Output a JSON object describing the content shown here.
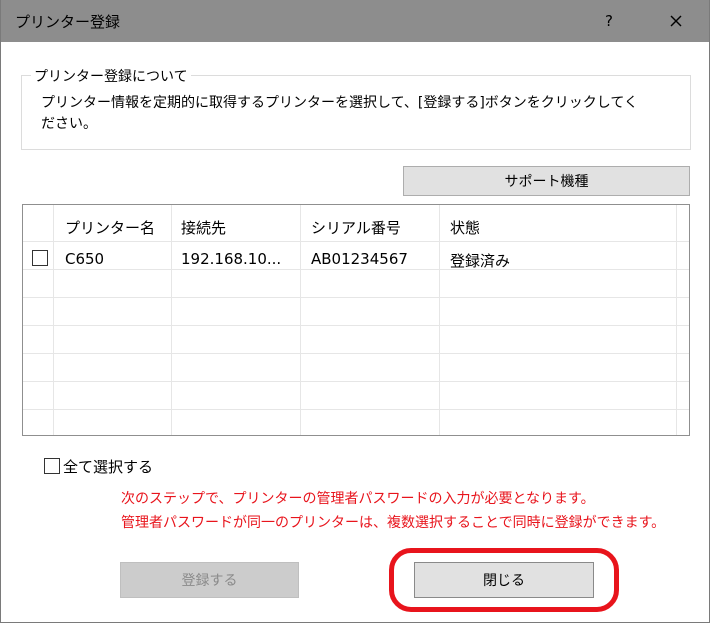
{
  "window": {
    "title": "プリンター登録",
    "help_label": "?",
    "close_label": "×"
  },
  "about": {
    "legend": "プリンター登録について",
    "description": "プリンター情報を定期的に取得するプリンターを選択して、[登録する]ボタンをクリックしてください。"
  },
  "support_button_label": "サポート機種",
  "table": {
    "columns": [
      "プリンター名",
      "接続先",
      "シリアル番号",
      "状態"
    ],
    "rows": [
      {
        "checked": false,
        "name": "C650",
        "address": "192.168.10...",
        "serial": "AB01234567",
        "status": "登録済み"
      }
    ]
  },
  "select_all_label": "全て選択する",
  "notes": [
    "次のステップで、プリンターの管理者パスワードの入力が必要となります。",
    "管理者パスワードが同一のプリンターは、複数選択することで同時に登録ができます。"
  ],
  "register_button_label": "登録する",
  "close_button_label": "閉じる",
  "colors": {
    "titlebar": "#8d8d8d",
    "note_text": "#e8141c",
    "highlight": "#e8141c"
  }
}
